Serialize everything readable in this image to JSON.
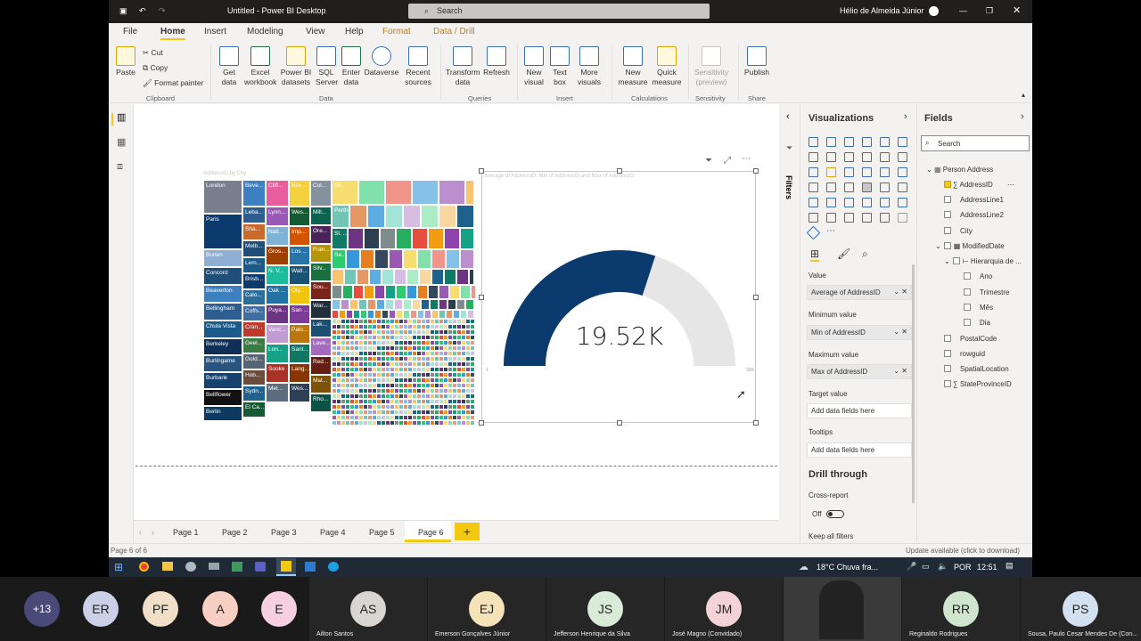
{
  "window": {
    "title": "Untitled - Power BI Desktop",
    "search_placeholder": "Search",
    "user": "Hélio de Almeida Júnior"
  },
  "ribbon_tabs": [
    "File",
    "Home",
    "Insert",
    "Modeling",
    "View",
    "Help",
    "Format",
    "Data / Drill"
  ],
  "ribbon": {
    "clipboard": {
      "paste": "Paste",
      "cut": "Cut",
      "copy": "Copy",
      "format_painter": "Format painter",
      "group": "Clipboard"
    },
    "data": {
      "get_data": "Get data",
      "excel": "Excel workbook",
      "pbi_datasets": "Power BI datasets",
      "sql": "SQL Server",
      "enter": "Enter data",
      "dataverse": "Dataverse",
      "recent": "Recent sources",
      "group": "Data"
    },
    "queries": {
      "transform": "Transform data",
      "refresh": "Refresh",
      "group": "Queries"
    },
    "insert": {
      "new_visual": "New visual",
      "text_box": "Text box",
      "more": "More visuals",
      "group": "Insert"
    },
    "calc": {
      "new_measure": "New measure",
      "quick": "Quick measure",
      "group": "Calculations"
    },
    "sensitivity": {
      "label": "Sensitivity (preview)",
      "group": "Sensitivity"
    },
    "share": {
      "publish": "Publish",
      "group": "Share"
    }
  },
  "treemap": {
    "title": "AddressID by City",
    "labels": [
      "London",
      "Paris",
      "Burien",
      "Concord",
      "Beaverton",
      "Bellingham",
      "Chula Vista",
      "Berkeley",
      "Burlingame",
      "Burbank",
      "Bellflower",
      "Berlin"
    ],
    "second_col": [
      "Beve...",
      "Leba...",
      "Sha...",
      "Melb...",
      "Lem...",
      "Brisb...",
      "Calo...",
      "Coffs...",
      "Cran...",
      "Geel...",
      "Gold...",
      "Hob...",
      "Sydn...",
      "El Ca..."
    ],
    "third_col": [
      "Cliff...",
      "Lynn...",
      "Nati...",
      "Gros...",
      "N. V...",
      "Oak ...",
      "Puya...",
      "Vanc...",
      "Lon...",
      "Sooke",
      "Met..."
    ],
    "fourth_col": [
      "Bre...",
      "Wes...",
      "Imp...",
      "Los ...",
      "Wall...",
      "Oly...",
      "San ...",
      "Palo...",
      "Sant...",
      "Lang...",
      "Wes..."
    ],
    "fifth_col": [
      "Col...",
      "Mill...",
      "Ore...",
      "Fran...",
      "Silv...",
      "Sou...",
      "War...",
      "Lak...",
      "Lave...",
      "Red...",
      "Mat...",
      "Rho..."
    ],
    "sixth_col": [
      "Sil...",
      "Perth",
      "St. ...",
      "Sa..."
    ]
  },
  "gauge": {
    "title": "Average of AddressID, Min of AddressID and Max of AddressID",
    "value_label": "19.52K",
    "min_label": "1",
    "max_label": "32K",
    "fill_fraction": 0.6,
    "fill_color": "#0b3a6e",
    "track_color": "#e6e6e6"
  },
  "page_tabs": [
    "Page 1",
    "Page 2",
    "Page 3",
    "Page 4",
    "Page 5",
    "Page 6"
  ],
  "active_page": "Page 6",
  "status": {
    "left": "Page 6 of 6",
    "right": "Update available (click to download)"
  },
  "filters_label": "Filters",
  "visualizations": {
    "title": "Visualizations",
    "wells": [
      {
        "label": "Value",
        "field": "Average of AddressID"
      },
      {
        "label": "Minimum value",
        "field": "Min of AddressID"
      },
      {
        "label": "Maximum value",
        "field": "Max of AddressID"
      },
      {
        "label": "Target value",
        "field": "Add data fields here"
      },
      {
        "label": "Tooltips",
        "field": "Add data fields here"
      }
    ],
    "drill_title": "Drill through",
    "cross_report": "Cross-report",
    "off": "Off",
    "keep_filters": "Keep all filters"
  },
  "fields": {
    "title": "Fields",
    "search_placeholder": "Search",
    "table": "Person Address",
    "items": [
      "AddressID",
      "AddressLine1",
      "AddressLine2",
      "City",
      "ModifiedDate",
      "Hierarquia de ...",
      "Ano",
      "Trimestre",
      "Mês",
      "Dia",
      "PostalCode",
      "rowguid",
      "SpatialLocation",
      "StateProvinceID"
    ]
  },
  "taskbar": {
    "weather": "18°C  Chuva fra...",
    "lang": "POR",
    "time": "12:51"
  },
  "meeting": {
    "more": "+13",
    "participants": [
      {
        "initials": "ER",
        "name": ""
      },
      {
        "initials": "PF",
        "name": ""
      },
      {
        "initials": "A",
        "name": ""
      },
      {
        "initials": "E",
        "name": ""
      },
      {
        "initials": "AS",
        "name": "Ailton Santos"
      },
      {
        "initials": "EJ",
        "name": "Emerson Gonçalves Júnior"
      },
      {
        "initials": "JS",
        "name": "Jefferson Henrique da Silva"
      },
      {
        "initials": "JM",
        "name": "José Magno (Convidado)"
      },
      {
        "initials": "RR",
        "name": "Reginaldo Rodrigues"
      },
      {
        "initials": "PS",
        "name": "Sousa, Paulo Cesar Mendes De (Con..."
      }
    ]
  }
}
